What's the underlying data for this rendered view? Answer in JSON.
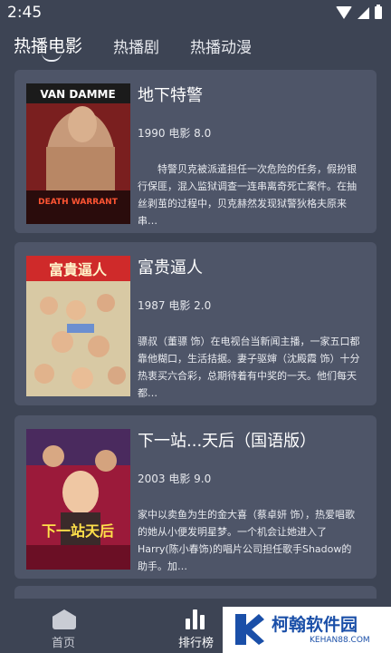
{
  "status": {
    "time": "2:45"
  },
  "tabs": [
    "热播电影",
    "热播剧",
    "热播动漫"
  ],
  "movies": [
    {
      "title": "地下特警",
      "meta": "1990 电影 8.0",
      "desc": "　　特警贝克被派遣担任一次危险的任务，假扮银行保匪，混入监狱调查一连串离奇死亡案件。在抽丝剥茧的过程中，贝克赫然发现狱警狄格夫原来串…",
      "poster_text_top": "VAN DAMME",
      "poster_text_bottom": "DEATH WARRANT"
    },
    {
      "title": "富贵逼人",
      "meta": "1987 电影 2.0",
      "desc": "骠叔（董骠 饰）在电视台当新闻主播，一家五口都靠他糊口，生活拮据。妻子驱婶（沈殿霞 饰）十分热衷买六合彩，总期待着有中奖的一天。他们每天都…",
      "poster_text_top": "富貴逼人"
    },
    {
      "title": "下一站...天后（国语版）",
      "meta": "2003 电影 9.0",
      "desc": "家中以卖鱼为生的金大喜（蔡卓妍 饰），热爱唱歌的她从小便发明星梦。一个机会让她进入了Harry(陈小春饰)的唱片公司担任歌手Shadow的助手。加…",
      "poster_text_top": "下一站天后"
    }
  ],
  "bottom_nav": {
    "home": "首页",
    "rank": "排行榜"
  },
  "watermark": {
    "name": "柯翰软件园",
    "site": "KEHAN88.COM"
  }
}
